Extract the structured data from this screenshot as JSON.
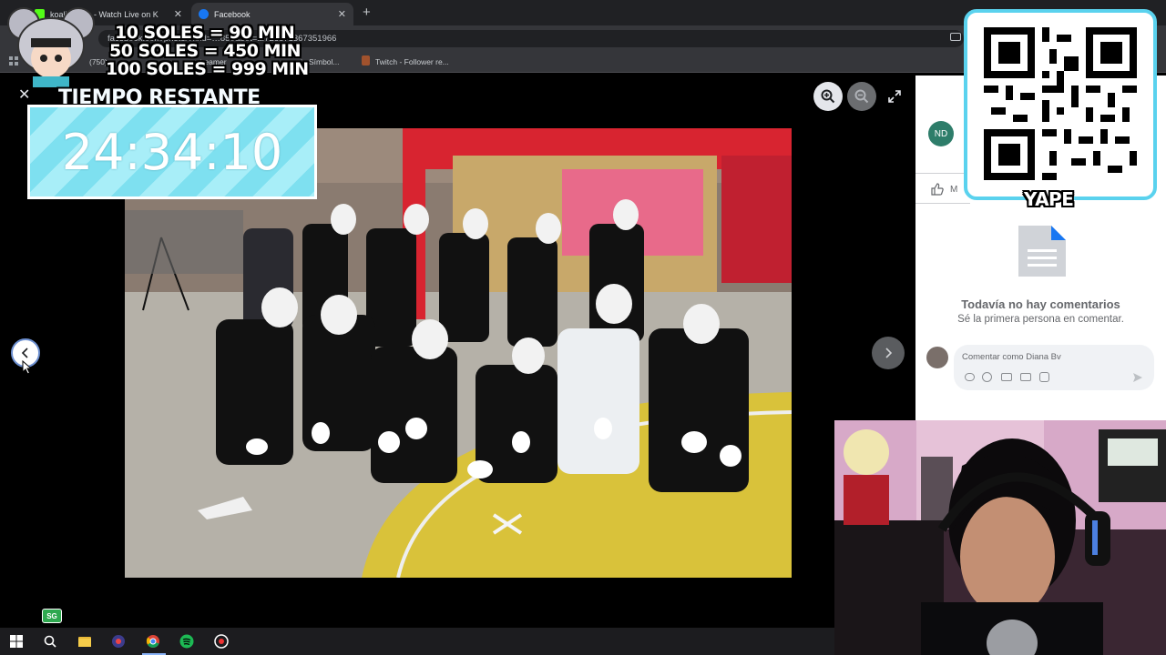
{
  "browser": {
    "tabs": [
      {
        "label": "koalita.com - Watch Live on K",
        "favicon": "kick-logo-icon"
      },
      {
        "label": "Facebook",
        "favicon": "facebook-logo-icon"
      }
    ],
    "address": "facebook.com/photo/?fbid=…856&set=a.726871367351966",
    "bookmarks": [
      "(750)",
      "streamer",
      "i : Símbol...",
      "Twitch - Follower re..."
    ]
  },
  "overlay": {
    "prices": [
      "10 SOLES = 90 MIN",
      "50 SOLES = 450 MIN",
      "100 SOLES = 999 MIN"
    ],
    "timer_label": "TIEMPO RESTANTE",
    "timer_value": "24:34:10",
    "qr_label": "YAPE",
    "badge": "SG"
  },
  "viewer": {
    "icons": {
      "close": "close-icon",
      "zoom_in": "zoom-in-icon",
      "zoom_out": "zoom-out-icon",
      "fullscreen": "fullscreen-icon",
      "prev": "chevron-left-icon",
      "next": "chevron-right-icon"
    }
  },
  "panel": {
    "page_initials": "ND",
    "like_label": "M",
    "empty_title": "Todavía no hay comentarios",
    "empty_subtitle": "Sé la primera persona en comentar.",
    "comment_placeholder": "Comentar como Diana Bv"
  },
  "colors": {
    "timer_stripe": "#7ee0f0",
    "qr_border": "#5ad2ee",
    "facebook_blue": "#1877f2"
  }
}
